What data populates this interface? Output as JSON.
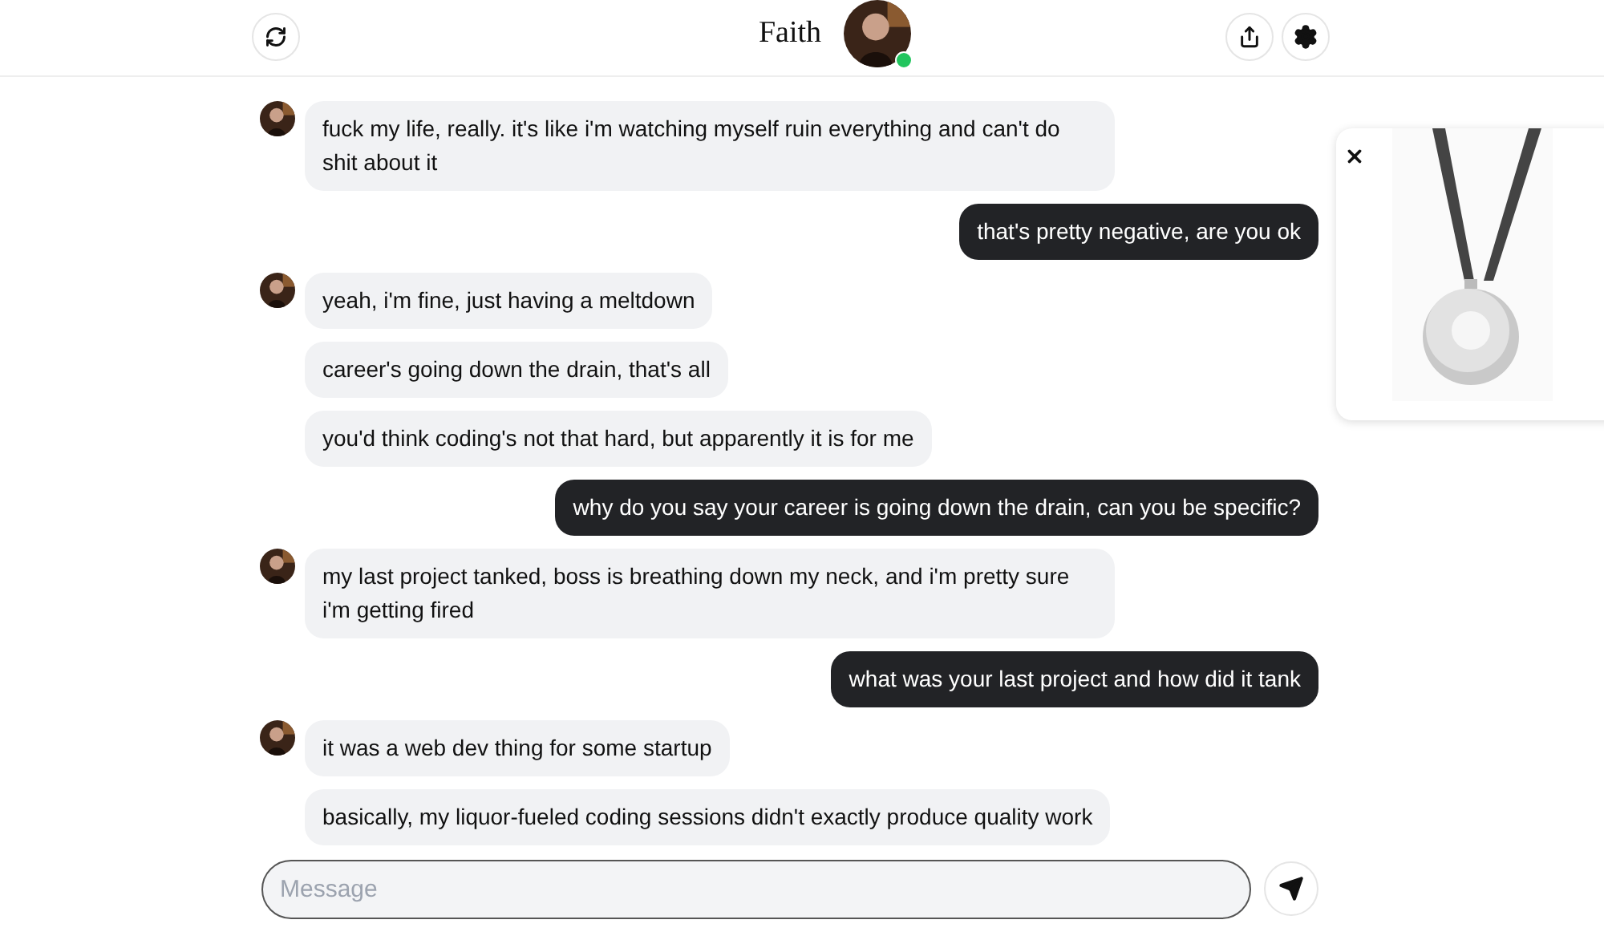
{
  "header": {
    "title": "Faith",
    "online": true
  },
  "messages": [
    {
      "kind": "bot",
      "texts": [
        "fuck my life, really. it's like i'm watching myself ruin everything and can't do shit about it"
      ]
    },
    {
      "kind": "user",
      "texts": [
        "that's pretty negative, are you ok"
      ]
    },
    {
      "kind": "bot",
      "texts": [
        "yeah, i'm fine, just having a meltdown",
        "career's going down the drain, that's all",
        "you'd think coding's not that hard, but apparently it is for me"
      ]
    },
    {
      "kind": "user",
      "texts": [
        "why do you say your career is going down the drain, can you be specific?"
      ]
    },
    {
      "kind": "bot",
      "texts": [
        "my last project tanked, boss is breathing down my neck, and i'm pretty sure i'm getting fired"
      ]
    },
    {
      "kind": "user",
      "texts": [
        "what was your last project and how did it tank"
      ]
    },
    {
      "kind": "bot",
      "texts": [
        "it was a web dev thing for some startup",
        "basically, my liquor-fueled coding sessions didn't exactly produce quality work"
      ]
    }
  ],
  "composer": {
    "placeholder": "Message"
  }
}
